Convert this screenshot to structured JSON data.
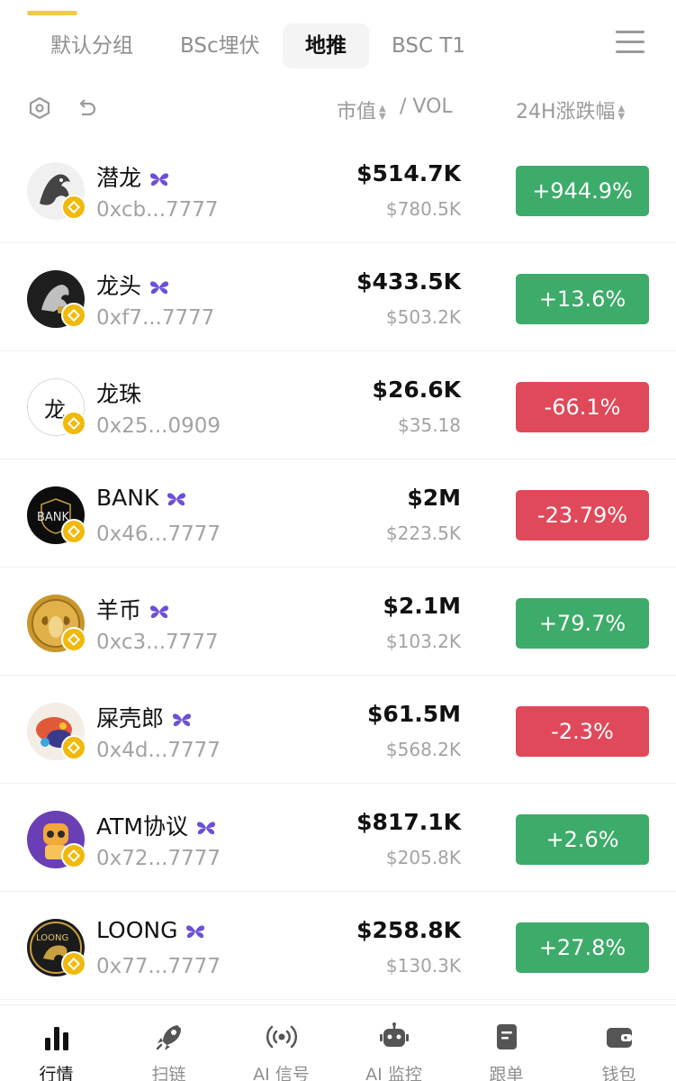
{
  "tabs": [
    {
      "label": "默认分组"
    },
    {
      "label": "BSc埋伏"
    },
    {
      "label": "地推"
    },
    {
      "label": "BSC T1"
    }
  ],
  "active_tab": "地推",
  "sort": {
    "mcap_label": "市值",
    "vol_label": "/ VOL",
    "change_label": "24H涨跌幅"
  },
  "tokens": [
    {
      "name": "潜龙",
      "addr": "0xcb...7777",
      "mcap": "$514.7K",
      "vol": "$780.5K",
      "change": "+944.9%",
      "dir": "up",
      "flag": true,
      "avatar_bg": "#e9e9e9",
      "avatar_text": ""
    },
    {
      "name": "龙头",
      "addr": "0xf7...7777",
      "mcap": "$433.5K",
      "vol": "$503.2K",
      "change": "+13.6%",
      "dir": "up",
      "flag": true,
      "avatar_bg": "#1e1e1e",
      "avatar_text": ""
    },
    {
      "name": "龙珠",
      "addr": "0x25...0909",
      "mcap": "$26.6K",
      "vol": "$35.18",
      "change": "-66.1%",
      "dir": "down",
      "flag": false,
      "avatar_bg": "#ffffff",
      "avatar_text": "龙"
    },
    {
      "name": "BANK",
      "addr": "0x46...7777",
      "mcap": "$2M",
      "vol": "$223.5K",
      "change": "-23.79%",
      "dir": "down",
      "flag": true,
      "avatar_bg": "#0d0d0d",
      "avatar_text": "BANK"
    },
    {
      "name": "羊币",
      "addr": "0xc3...7777",
      "mcap": "$2.1M",
      "vol": "$103.2K",
      "change": "+79.7%",
      "dir": "up",
      "flag": true,
      "avatar_bg": "#c9962b",
      "avatar_text": ""
    },
    {
      "name": "屎壳郎",
      "addr": "0x4d...7777",
      "mcap": "$61.5M",
      "vol": "$568.2K",
      "change": "-2.3%",
      "dir": "down",
      "flag": true,
      "avatar_bg": "#f3ede6",
      "avatar_text": ""
    },
    {
      "name": "ATM协议",
      "addr": "0x72...7777",
      "mcap": "$817.1K",
      "vol": "$205.8K",
      "change": "+2.6%",
      "dir": "up",
      "flag": true,
      "avatar_bg": "#6a3fb5",
      "avatar_text": ""
    },
    {
      "name": "LOONG",
      "addr": "0x77...7777",
      "mcap": "$258.8K",
      "vol": "$130.3K",
      "change": "+27.8%",
      "dir": "up",
      "flag": true,
      "avatar_bg": "#1b1b1b",
      "avatar_text": "LOONG"
    }
  ],
  "colors": {
    "up": "#3dab6a",
    "down": "#e0495a",
    "accent": "#f2c94c",
    "flag": "#6b4fd8",
    "chain": "#f0b90b"
  },
  "bottom_nav": [
    {
      "label": "行情",
      "icon": "bar-chart-icon"
    },
    {
      "label": "扫链",
      "icon": "rocket-icon"
    },
    {
      "label": "AI 信号",
      "icon": "signal-broadcast-icon"
    },
    {
      "label": "AI 监控",
      "icon": "robot-icon"
    },
    {
      "label": "跟单",
      "icon": "document-icon"
    },
    {
      "label": "钱包",
      "icon": "wallet-icon"
    }
  ],
  "active_nav": "行情"
}
